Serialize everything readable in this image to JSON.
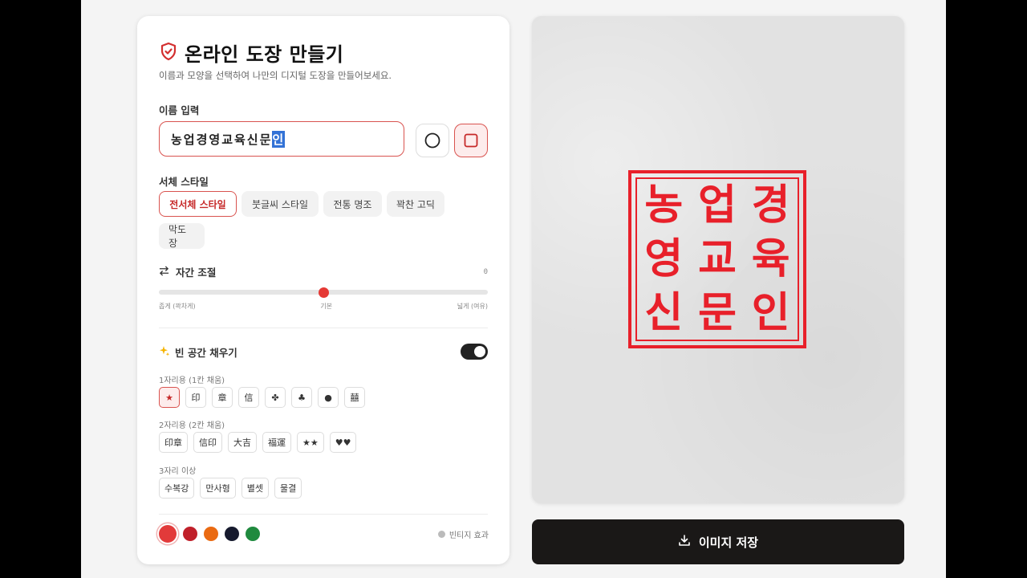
{
  "header": {
    "title": "온라인 도장 만들기",
    "subtitle": "이름과 모양을 선택하여 나만의 디지털 도장을 만들어보세요."
  },
  "name_section": {
    "label": "이름 입력",
    "value_main": "농업경영교육신문",
    "value_selected": "인"
  },
  "font_section": {
    "label": "서체 스타일",
    "options": [
      "전서체 스타일",
      "붓글씨 스타일",
      "전통 명조",
      "꽉찬 고딕",
      "막도장"
    ],
    "selected": "전서체 스타일"
  },
  "spacing": {
    "label": "자간 조절",
    "value": "0",
    "min_label": "좁게 (꽉차게)",
    "mid_label": "기본",
    "max_label": "넓게 (여유)",
    "level": 0.5
  },
  "fill": {
    "label": "빈 공간 채우기",
    "enabled": true,
    "group1_label": "1자리용 (1칸 채움)",
    "group1": [
      "★",
      "印",
      "章",
      "信",
      "✤",
      "♣",
      "●",
      "囍"
    ],
    "group2_label": "2자리용 (2칸 채움)",
    "group2": [
      "印章",
      "信印",
      "大吉",
      "福運",
      "★★",
      "♥♥"
    ],
    "group3_label": "3자리 이상",
    "group3": [
      "수복강",
      "만사형",
      "별셋",
      "물결"
    ]
  },
  "colors": {
    "swatches": [
      "#e23a3a",
      "#c0202a",
      "#ea6a12",
      "#161a2e",
      "#1f8a3e"
    ],
    "selected": "#e23a3a"
  },
  "vintage_label": "빈티지 효과",
  "stamp": {
    "chars": [
      "농",
      "업",
      "경",
      "영",
      "교",
      "육",
      "신",
      "문",
      "인"
    ],
    "color": "#e8202a"
  },
  "save_label": "이미지 저장"
}
